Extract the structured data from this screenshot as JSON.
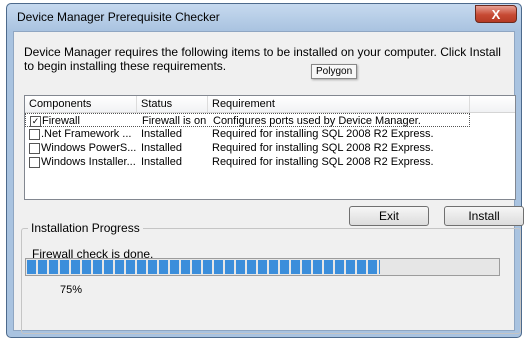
{
  "window": {
    "title": "Device Manager Prerequisite Checker",
    "close_glyph": "X"
  },
  "intro_text": "Device Manager requires the following items to be installed on your computer. Click Install to begin installing these requirements.",
  "tooltip": "Polygon",
  "list": {
    "columns": [
      "Components",
      "Status",
      "Requirement"
    ],
    "rows": [
      {
        "checked": true,
        "check_glyph": "✓",
        "component": "Firewall",
        "status": "Firewall is on",
        "requirement": "Configures ports used by Device Manager."
      },
      {
        "checked": false,
        "check_glyph": "",
        "component": ".Net Framework ...",
        "status": "Installed",
        "requirement": "Required for installing SQL 2008 R2 Express."
      },
      {
        "checked": false,
        "check_glyph": "",
        "component": "Windows PowerS...",
        "status": "Installed",
        "requirement": "Required for installing SQL 2008 R2 Express."
      },
      {
        "checked": false,
        "check_glyph": "",
        "component": "Windows Installer...",
        "status": "Installed",
        "requirement": "Required for installing SQL 2008 R2 Express."
      }
    ]
  },
  "buttons": {
    "exit": "Exit",
    "install": "Install"
  },
  "progress": {
    "group_label": "Installation Progress",
    "status": "Firewall check is done.",
    "percent_value": 75,
    "percent_label": "75%",
    "color": "#3b8edb"
  },
  "colors": {
    "titlebar": "#a9c3e0",
    "close_button": "#c74a34"
  }
}
